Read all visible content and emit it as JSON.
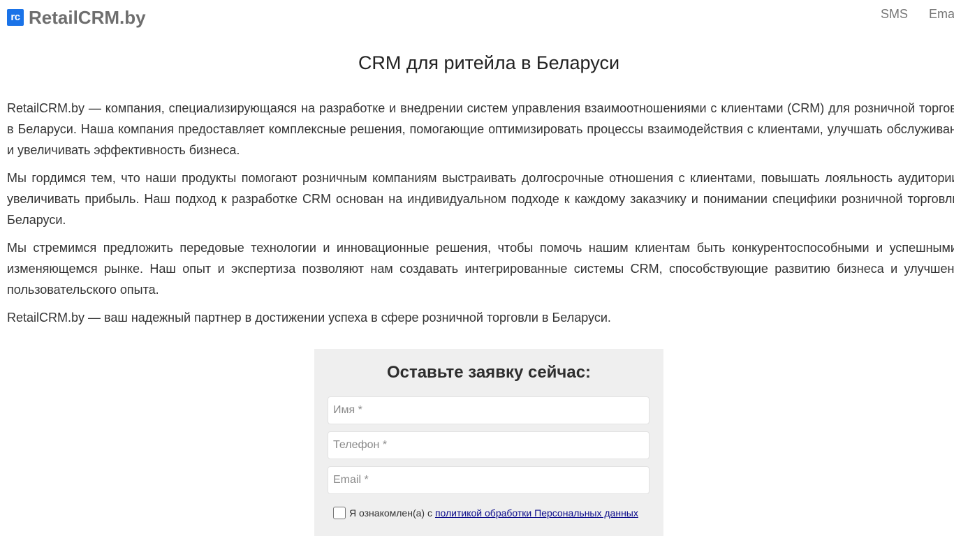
{
  "header": {
    "logo_badge": "rc",
    "logo_text": "RetailCRM.by",
    "nav": [
      {
        "label": "SMS"
      },
      {
        "label": "Email"
      }
    ]
  },
  "main": {
    "title": "CRM для ритейла в Беларуси",
    "paragraphs": [
      "RetailCRM.by — компания, специализирующаяся на разработке и внедрении систем управления взаимоотношениями с клиентами (CRM) для розничной торговли в Беларуси. Наша компания предоставляет комплексные решения, помогающие оптимизировать процессы взаимодействия с клиентами, улучшать обслуживание и увеличивать эффективность бизнеса.",
      "Мы гордимся тем, что наши продукты помогают розничным компаниям выстраивать долгосрочные отношения с клиентами, повышать лояльность аудитории и увеличивать прибыль. Наш подход к разработке CRM основан на индивидуальном подходе к каждому заказчику и понимании специфики розничной торговли в Беларуси.",
      "Мы стремимся предложить передовые технологии и инновационные решения, чтобы помочь нашим клиентам быть конкурентоспособными и успешными в изменяющемся рынке. Наш опыт и экспертиза позволяют нам создавать интегрированные системы CRM, способствующие развитию бизнеса и улучшению пользовательского опыта.",
      "RetailCRM.by — ваш надежный партнер в достижении успеха в сфере розничной торговли в Беларуси."
    ]
  },
  "form": {
    "heading": "Оставьте заявку сейчас:",
    "name_placeholder": "Имя *",
    "phone_placeholder": "Телефон *",
    "email_placeholder": "Email *",
    "consent_text": "Я ознакомлен(а) с",
    "consent_link": "политикой обработки Персональных данных"
  },
  "colors": {
    "accent": "#1a73e8",
    "form_bg": "#efefef",
    "link": "#0b0b8a"
  }
}
